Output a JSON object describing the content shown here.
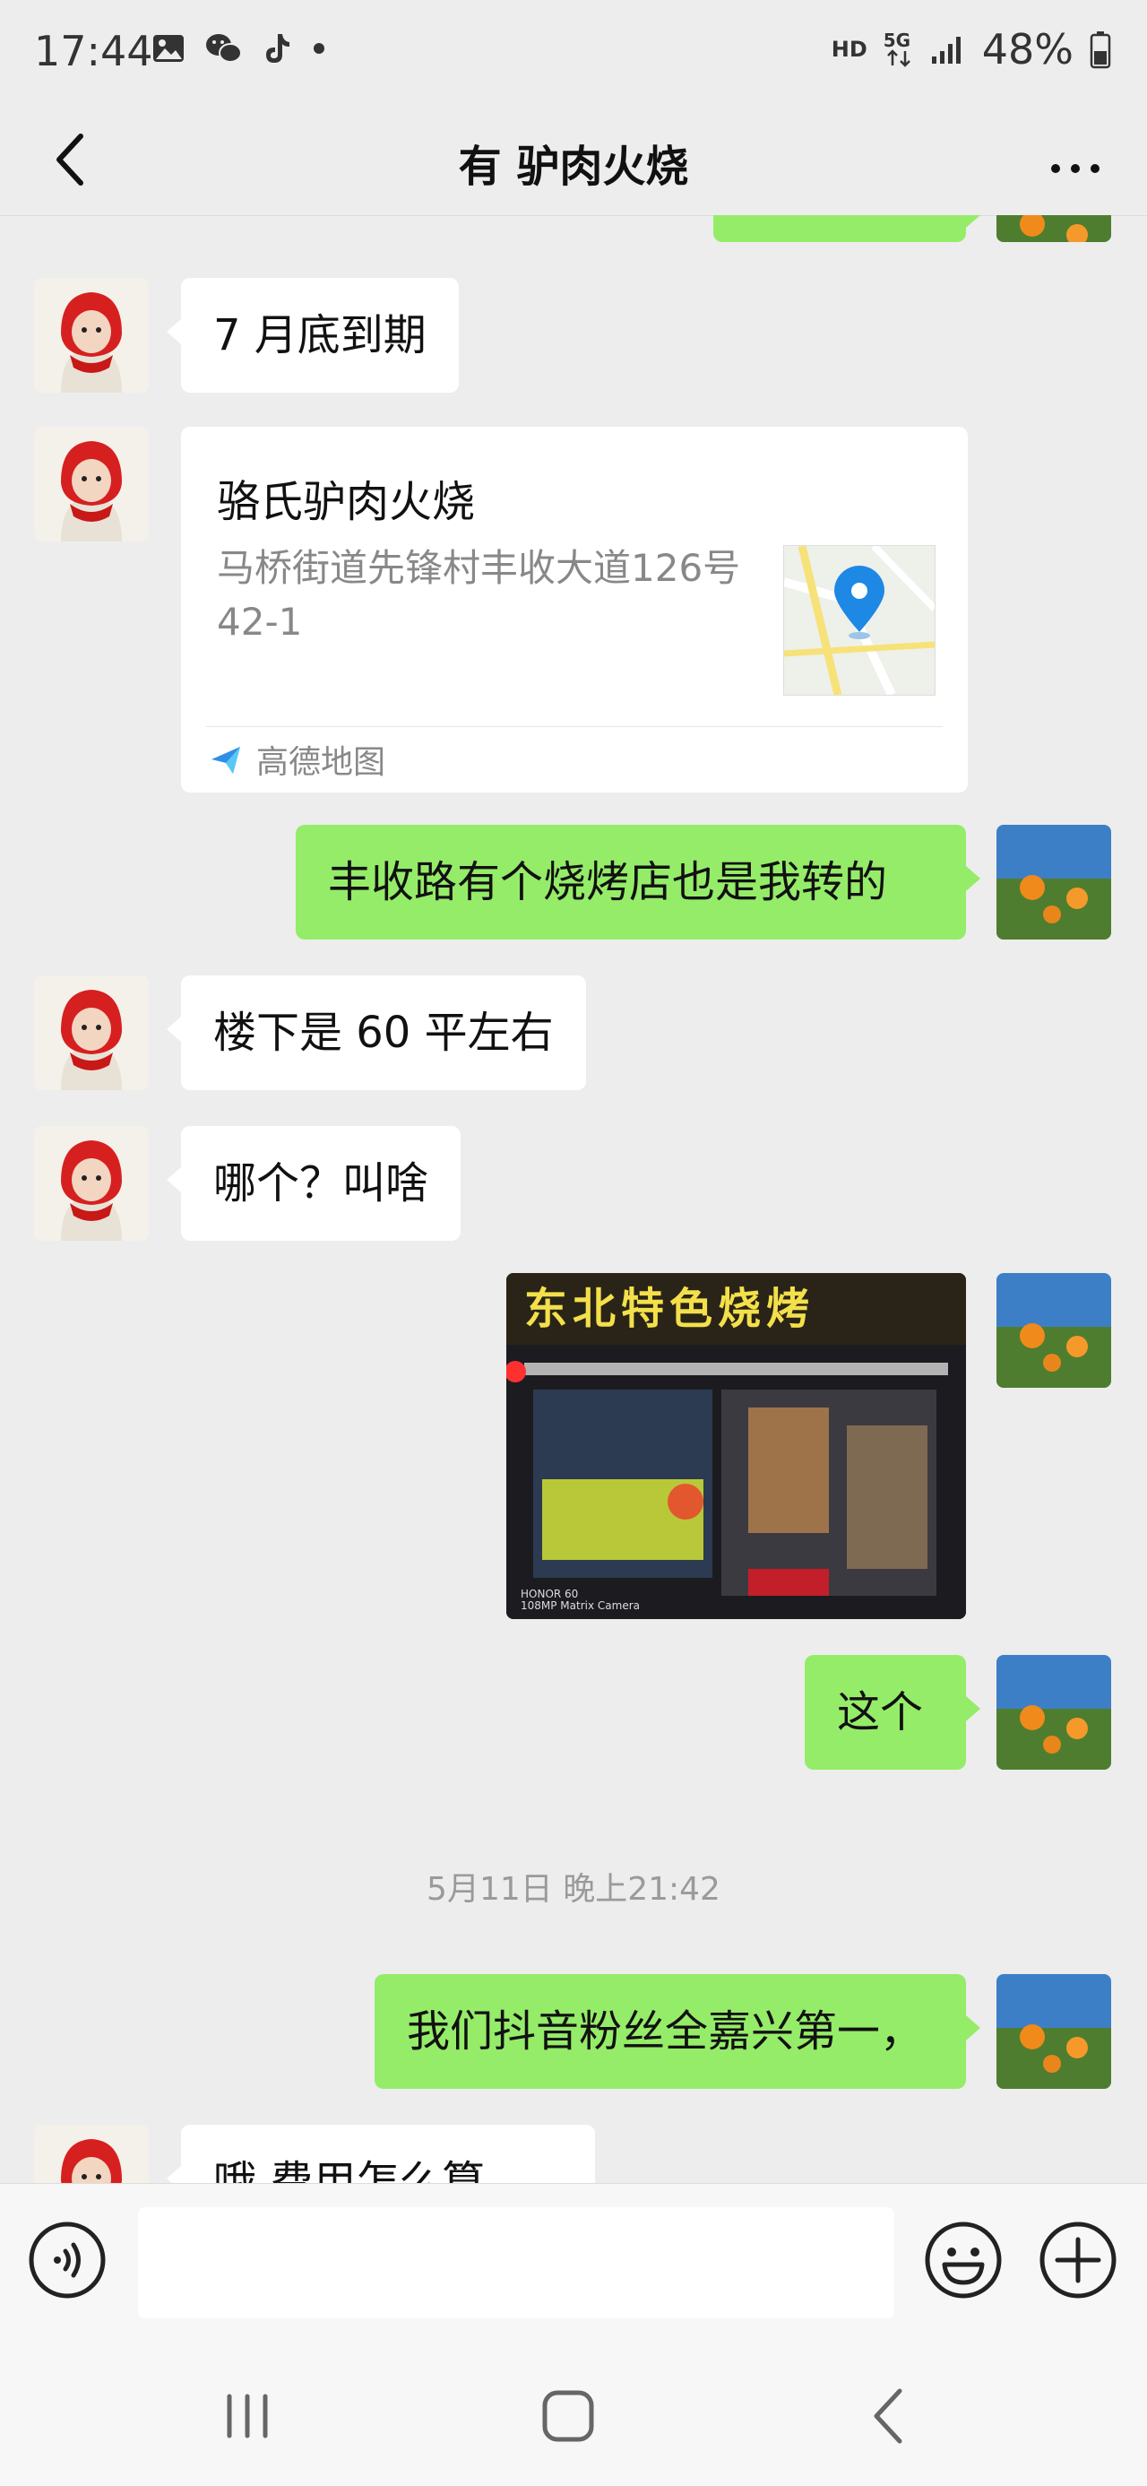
{
  "status": {
    "time": "17:44",
    "battery": "48%",
    "net_hd": "HD",
    "net_5g": "5G",
    "icons_left": [
      "gallery-icon",
      "wechat-icon",
      "tiktok-icon",
      "dot-icon"
    ],
    "icons_right": [
      "hd-icon",
      "5g-icon",
      "signal-icon",
      "battery-icon"
    ]
  },
  "header": {
    "title": "有 驴肉火烧",
    "back_icon": "chevron-left-icon",
    "more_icon": "more-dots-icon"
  },
  "messages": [
    {
      "side": "in",
      "type": "text",
      "text": "7 月底到期"
    },
    {
      "side": "in",
      "type": "location",
      "title": "骆氏驴肉火烧",
      "address": "马桥街道先锋村丰收大道126号42-1",
      "source": "高德地图"
    },
    {
      "side": "out",
      "type": "text",
      "text": "丰收路有个烧烤店也是我转的"
    },
    {
      "side": "in",
      "type": "text",
      "text": "楼下是 60 平左右"
    },
    {
      "side": "in",
      "type": "text",
      "text": "哪个？叫啥"
    },
    {
      "side": "out",
      "type": "image",
      "sign_text": "东北特色烧烤",
      "watermark_line1": "HONOR 60",
      "watermark_line2": "108MP Matrix Camera"
    },
    {
      "side": "out",
      "type": "text",
      "text": "这个"
    },
    {
      "side": "system",
      "type": "timestamp",
      "text": "5月11日 晚上21:42"
    },
    {
      "side": "out",
      "type": "text",
      "text": "我们抖音粉丝全嘉兴第一，"
    },
    {
      "side": "in",
      "type": "text",
      "text": "哦 费用怎么算"
    }
  ],
  "input_bar": {
    "voice_icon": "voice-icon",
    "emoji_icon": "emoji-icon",
    "plus_icon": "plus-icon",
    "value": ""
  },
  "system_nav": {
    "recents_icon": "recents-icon",
    "home_icon": "home-icon",
    "back_icon": "back-nav-icon"
  },
  "colors": {
    "background": "#ededed",
    "incoming_bubble": "#ffffff",
    "outgoing_bubble": "#95ec69",
    "timestamp": "#9a9a9a",
    "map_pin": "#1e88e5"
  }
}
